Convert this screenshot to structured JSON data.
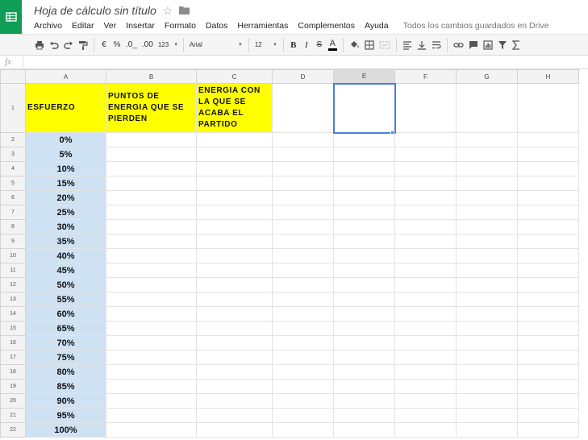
{
  "app": {
    "title": "Hoja de cálculo sin título",
    "logo_icon": "sheets-grid-icon",
    "star_icon": "☆",
    "folder_icon": "folder-icon"
  },
  "menu": {
    "items": [
      "Archivo",
      "Editar",
      "Ver",
      "Insertar",
      "Formato",
      "Datos",
      "Herramientas",
      "Complementos",
      "Ayuda"
    ],
    "save_status": "Todos los cambios guardados en Drive"
  },
  "toolbar": {
    "currency": "€",
    "percent": "%",
    "decrease_decimals": ".0_",
    "increase_decimals": ".00",
    "more_formats": "123",
    "font": "Arial",
    "font_size": "12",
    "bold": "B",
    "italic": "I",
    "strikethrough": "S",
    "text_color": "A",
    "text_color_hex": "#000000"
  },
  "formula_bar": {
    "fx": "fx",
    "value": ""
  },
  "grid": {
    "columns": [
      "A",
      "B",
      "C",
      "D",
      "E",
      "F",
      "G",
      "H"
    ],
    "active_column": "E",
    "headers": {
      "A1": "ESFUERZO",
      "B1": "PUNTOS DE ENERGIA QUE SE PIERDEN",
      "C1": "ENERGIA CON LA QUE SE ACABA EL PARTIDO"
    },
    "rows": [
      {
        "row": "2",
        "a": "0%"
      },
      {
        "row": "3",
        "a": "5%"
      },
      {
        "row": "4",
        "a": "10%"
      },
      {
        "row": "5",
        "a": "15%"
      },
      {
        "row": "6",
        "a": "20%"
      },
      {
        "row": "7",
        "a": "25%"
      },
      {
        "row": "8",
        "a": "30%"
      },
      {
        "row": "9",
        "a": "35%"
      },
      {
        "row": "10",
        "a": "40%"
      },
      {
        "row": "11",
        "a": "45%"
      },
      {
        "row": "12",
        "a": "50%"
      },
      {
        "row": "13",
        "a": "55%"
      },
      {
        "row": "14",
        "a": "60%"
      },
      {
        "row": "15",
        "a": "65%"
      },
      {
        "row": "16",
        "a": "70%"
      },
      {
        "row": "17",
        "a": "75%"
      },
      {
        "row": "18",
        "a": "80%"
      },
      {
        "row": "19",
        "a": "85%"
      },
      {
        "row": "20",
        "a": "90%"
      },
      {
        "row": "21",
        "a": "95%"
      },
      {
        "row": "22",
        "a": "100%"
      }
    ],
    "header_fill": "#ffff00",
    "value_fill": "#cfe2f3",
    "selection_color": "#4a7fd8"
  }
}
